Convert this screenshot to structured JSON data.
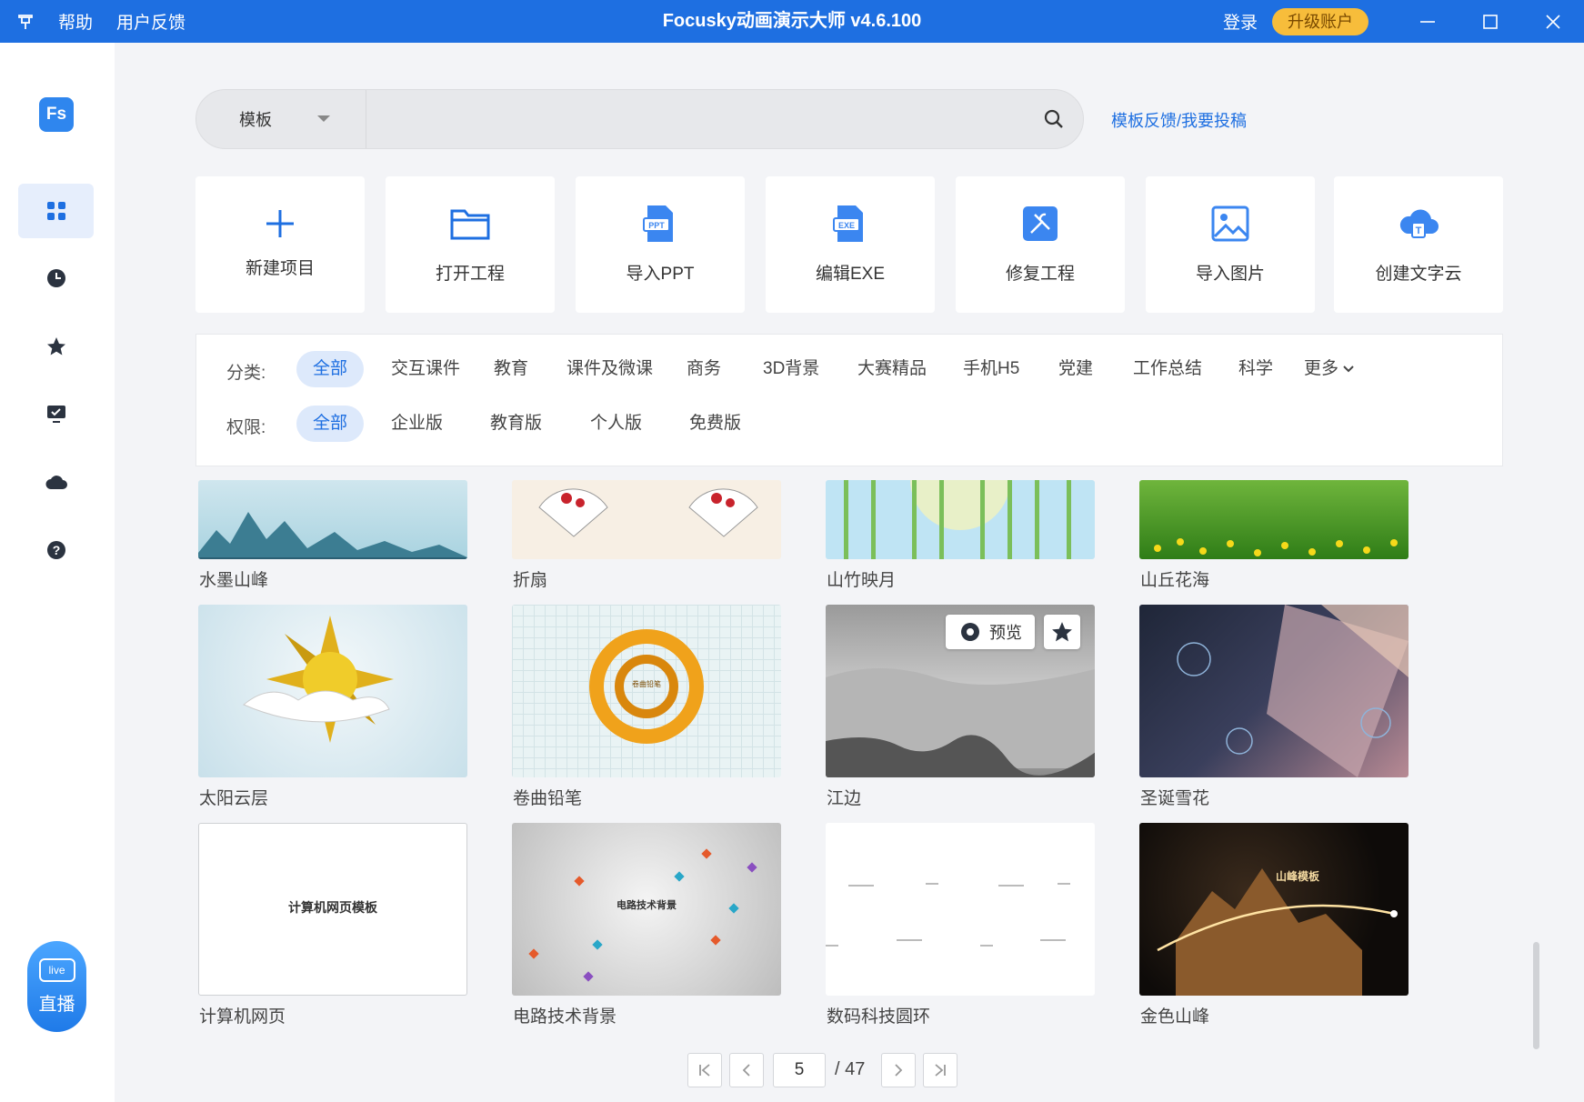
{
  "titlebar": {
    "menu_help": "帮助",
    "menu_feedback": "用户反馈",
    "title": "Focusky动画演示大师 v4.6.100",
    "login": "登录",
    "upgrade": "升级账户"
  },
  "sidebar": {
    "logo": "Fs",
    "items": [
      "grid-icon",
      "clock-icon",
      "star-icon",
      "monitor-check-icon",
      "cloud-icon",
      "help-icon"
    ],
    "live_badge": "live",
    "live_label": "直播"
  },
  "search": {
    "type_label": "模板",
    "placeholder": "",
    "feedback_link": "模板反馈/我要投稿"
  },
  "actions": [
    {
      "label": "新建项目",
      "icon": "plus-icon"
    },
    {
      "label": "打开工程",
      "icon": "folder-icon"
    },
    {
      "label": "导入PPT",
      "icon": "ppt-file-icon"
    },
    {
      "label": "编辑EXE",
      "icon": "exe-file-icon"
    },
    {
      "label": "修复工程",
      "icon": "tools-icon"
    },
    {
      "label": "导入图片",
      "icon": "image-icon"
    },
    {
      "label": "创建文字云",
      "icon": "cloud-text-icon"
    }
  ],
  "filters": {
    "category_label": "分类:",
    "categories": [
      "全部",
      "交互课件",
      "教育",
      "课件及微课",
      "商务",
      "3D背景",
      "大赛精品",
      "手机H5",
      "党建",
      "工作总结",
      "科学",
      "更多"
    ],
    "permission_label": "权限:",
    "permissions": [
      "全部",
      "企业版",
      "教育版",
      "个人版",
      "免费版"
    ]
  },
  "templates": [
    {
      "name": "水墨山峰"
    },
    {
      "name": "折扇"
    },
    {
      "name": "山竹映月"
    },
    {
      "name": "山丘花海"
    },
    {
      "name": "太阳云层"
    },
    {
      "name": "卷曲铅笔",
      "thumb_text": "卷曲铅笔"
    },
    {
      "name": "江边"
    },
    {
      "name": "圣诞雪花"
    },
    {
      "name": "计算机网页",
      "thumb_text": "计算机网页模板"
    },
    {
      "name": "电路技术背景",
      "thumb_text": "电路技术背景"
    },
    {
      "name": "数码科技圆环"
    },
    {
      "name": "金色山峰",
      "thumb_text": "山峰模板"
    }
  ],
  "hover": {
    "preview_label": "预览"
  },
  "pagination": {
    "current": "5",
    "total": "/ 47"
  },
  "colors": {
    "accent": "#1e6fe1",
    "upgrade": "#f7bd3b"
  }
}
